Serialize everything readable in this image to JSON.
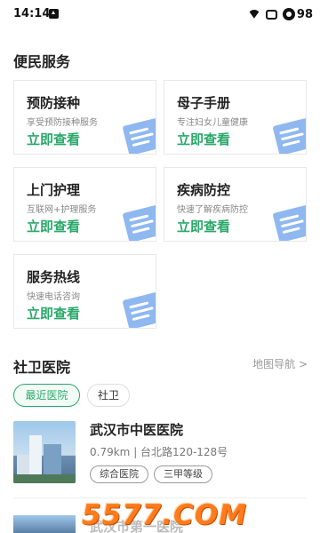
{
  "status_bar": {
    "time": "14:14",
    "battery": "98"
  },
  "services": {
    "title": "便民服务",
    "cards": [
      {
        "title": "预防接种",
        "subtitle": "享受预防接种服务",
        "cta": "立即查看"
      },
      {
        "title": "母子手册",
        "subtitle": "专注妇女儿童健康",
        "cta": "立即查看"
      },
      {
        "title": "上门护理",
        "subtitle": "互联网+护理服务",
        "cta": "立即查看"
      },
      {
        "title": "疾病防控",
        "subtitle": "快速了解疾病防控",
        "cta": "立即查看"
      },
      {
        "title": "服务热线",
        "subtitle": "快速电话咨询",
        "cta": "立即查看"
      }
    ],
    "accent_color": "#2aa86a",
    "icon_color": "#8fb8f0"
  },
  "hospitals": {
    "title": "社卫医院",
    "map_link": "地图导航 >",
    "tabs": [
      {
        "label": "最近医院",
        "active": true
      },
      {
        "label": "社卫",
        "active": false
      }
    ],
    "items": [
      {
        "name": "武汉市中医医院",
        "distance": "0.79km",
        "address": "台北路120-128号",
        "tags": [
          "综合医院",
          "三甲等级"
        ]
      }
    ],
    "next_item_partial": "武汉市第一医院"
  },
  "watermark": "5577.COM"
}
